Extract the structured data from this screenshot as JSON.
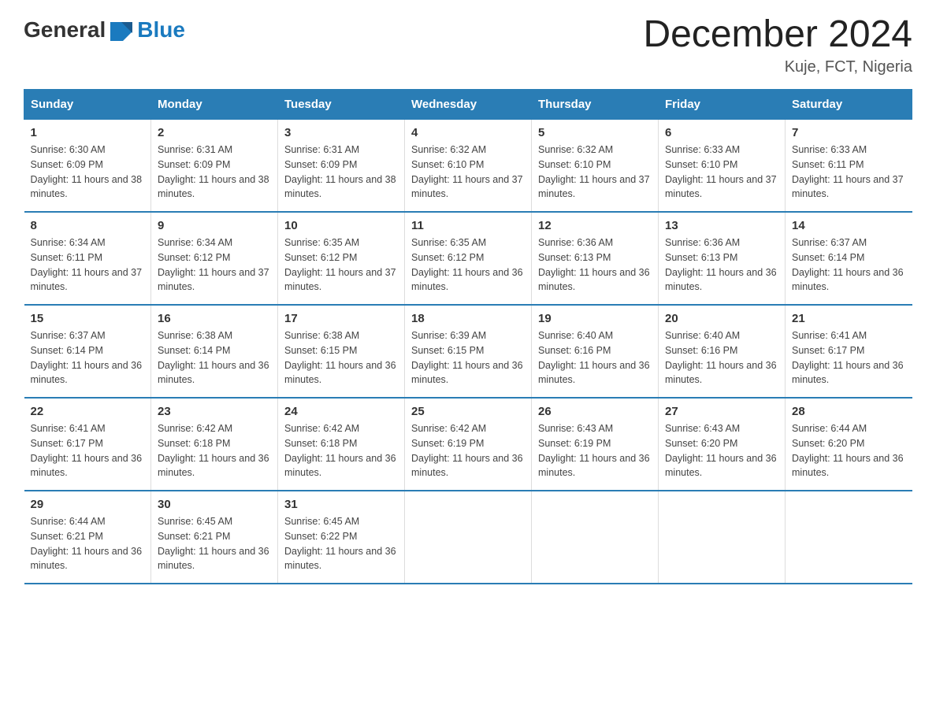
{
  "header": {
    "logo_general": "General",
    "logo_blue": "Blue",
    "month_title": "December 2024",
    "location": "Kuje, FCT, Nigeria"
  },
  "weekdays": [
    "Sunday",
    "Monday",
    "Tuesday",
    "Wednesday",
    "Thursday",
    "Friday",
    "Saturday"
  ],
  "weeks": [
    [
      {
        "day": "1",
        "sunrise": "6:30 AM",
        "sunset": "6:09 PM",
        "daylight": "11 hours and 38 minutes."
      },
      {
        "day": "2",
        "sunrise": "6:31 AM",
        "sunset": "6:09 PM",
        "daylight": "11 hours and 38 minutes."
      },
      {
        "day": "3",
        "sunrise": "6:31 AM",
        "sunset": "6:09 PM",
        "daylight": "11 hours and 38 minutes."
      },
      {
        "day": "4",
        "sunrise": "6:32 AM",
        "sunset": "6:10 PM",
        "daylight": "11 hours and 37 minutes."
      },
      {
        "day": "5",
        "sunrise": "6:32 AM",
        "sunset": "6:10 PM",
        "daylight": "11 hours and 37 minutes."
      },
      {
        "day": "6",
        "sunrise": "6:33 AM",
        "sunset": "6:10 PM",
        "daylight": "11 hours and 37 minutes."
      },
      {
        "day": "7",
        "sunrise": "6:33 AM",
        "sunset": "6:11 PM",
        "daylight": "11 hours and 37 minutes."
      }
    ],
    [
      {
        "day": "8",
        "sunrise": "6:34 AM",
        "sunset": "6:11 PM",
        "daylight": "11 hours and 37 minutes."
      },
      {
        "day": "9",
        "sunrise": "6:34 AM",
        "sunset": "6:12 PM",
        "daylight": "11 hours and 37 minutes."
      },
      {
        "day": "10",
        "sunrise": "6:35 AM",
        "sunset": "6:12 PM",
        "daylight": "11 hours and 37 minutes."
      },
      {
        "day": "11",
        "sunrise": "6:35 AM",
        "sunset": "6:12 PM",
        "daylight": "11 hours and 36 minutes."
      },
      {
        "day": "12",
        "sunrise": "6:36 AM",
        "sunset": "6:13 PM",
        "daylight": "11 hours and 36 minutes."
      },
      {
        "day": "13",
        "sunrise": "6:36 AM",
        "sunset": "6:13 PM",
        "daylight": "11 hours and 36 minutes."
      },
      {
        "day": "14",
        "sunrise": "6:37 AM",
        "sunset": "6:14 PM",
        "daylight": "11 hours and 36 minutes."
      }
    ],
    [
      {
        "day": "15",
        "sunrise": "6:37 AM",
        "sunset": "6:14 PM",
        "daylight": "11 hours and 36 minutes."
      },
      {
        "day": "16",
        "sunrise": "6:38 AM",
        "sunset": "6:14 PM",
        "daylight": "11 hours and 36 minutes."
      },
      {
        "day": "17",
        "sunrise": "6:38 AM",
        "sunset": "6:15 PM",
        "daylight": "11 hours and 36 minutes."
      },
      {
        "day": "18",
        "sunrise": "6:39 AM",
        "sunset": "6:15 PM",
        "daylight": "11 hours and 36 minutes."
      },
      {
        "day": "19",
        "sunrise": "6:40 AM",
        "sunset": "6:16 PM",
        "daylight": "11 hours and 36 minutes."
      },
      {
        "day": "20",
        "sunrise": "6:40 AM",
        "sunset": "6:16 PM",
        "daylight": "11 hours and 36 minutes."
      },
      {
        "day": "21",
        "sunrise": "6:41 AM",
        "sunset": "6:17 PM",
        "daylight": "11 hours and 36 minutes."
      }
    ],
    [
      {
        "day": "22",
        "sunrise": "6:41 AM",
        "sunset": "6:17 PM",
        "daylight": "11 hours and 36 minutes."
      },
      {
        "day": "23",
        "sunrise": "6:42 AM",
        "sunset": "6:18 PM",
        "daylight": "11 hours and 36 minutes."
      },
      {
        "day": "24",
        "sunrise": "6:42 AM",
        "sunset": "6:18 PM",
        "daylight": "11 hours and 36 minutes."
      },
      {
        "day": "25",
        "sunrise": "6:42 AM",
        "sunset": "6:19 PM",
        "daylight": "11 hours and 36 minutes."
      },
      {
        "day": "26",
        "sunrise": "6:43 AM",
        "sunset": "6:19 PM",
        "daylight": "11 hours and 36 minutes."
      },
      {
        "day": "27",
        "sunrise": "6:43 AM",
        "sunset": "6:20 PM",
        "daylight": "11 hours and 36 minutes."
      },
      {
        "day": "28",
        "sunrise": "6:44 AM",
        "sunset": "6:20 PM",
        "daylight": "11 hours and 36 minutes."
      }
    ],
    [
      {
        "day": "29",
        "sunrise": "6:44 AM",
        "sunset": "6:21 PM",
        "daylight": "11 hours and 36 minutes."
      },
      {
        "day": "30",
        "sunrise": "6:45 AM",
        "sunset": "6:21 PM",
        "daylight": "11 hours and 36 minutes."
      },
      {
        "day": "31",
        "sunrise": "6:45 AM",
        "sunset": "6:22 PM",
        "daylight": "11 hours and 36 minutes."
      },
      null,
      null,
      null,
      null
    ]
  ]
}
